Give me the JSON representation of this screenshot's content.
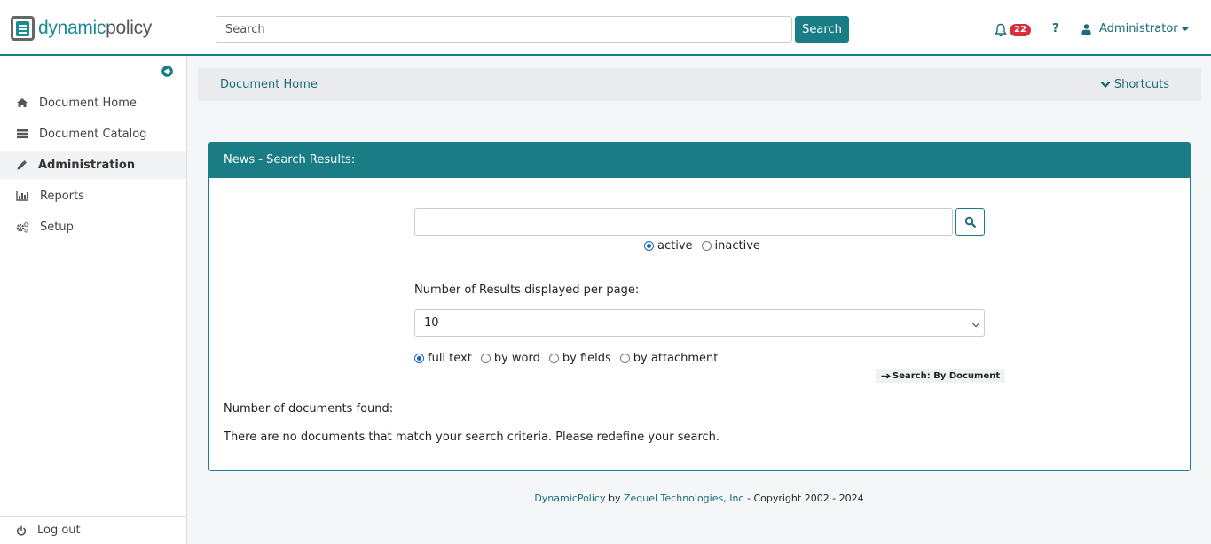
{
  "app": {
    "logo_part1": "dynamic",
    "logo_part2": "policy",
    "logo_text": "dynamicpolicy"
  },
  "topbar": {
    "search_placeholder": "Search",
    "search_button": "Search",
    "notification_count": "22",
    "help_label": "?",
    "user_name": "Administrator"
  },
  "sidebar": {
    "items": [
      {
        "label": "Document Home",
        "icon": "home-icon"
      },
      {
        "label": "Document Catalog",
        "icon": "list-icon"
      },
      {
        "label": "Administration",
        "icon": "pencil-icon",
        "active": true
      },
      {
        "label": "Reports",
        "icon": "bar-chart-icon"
      },
      {
        "label": "Setup",
        "icon": "gears-icon"
      }
    ],
    "logout_label": "Log out"
  },
  "breadcrumb": {
    "current": "Document Home",
    "shortcuts_label": "Shortcuts"
  },
  "panel": {
    "title": "News - Search Results:",
    "search_value": "",
    "status_options": [
      {
        "label": "active",
        "selected": true
      },
      {
        "label": "inactive",
        "selected": false
      }
    ],
    "per_page_label": "Number of Results displayed per page:",
    "per_page_value": "10",
    "mode_options": [
      {
        "label": "full text",
        "selected": true
      },
      {
        "label": "by word",
        "selected": false
      },
      {
        "label": "by fields",
        "selected": false
      },
      {
        "label": "by attachment",
        "selected": false
      }
    ],
    "by_document_link": "Search: By Document",
    "found_label": "Number of documents found:",
    "no_results_message": "There are no documents that match your search criteria. Please redefine your search."
  },
  "footer": {
    "product": "DynamicPolicy",
    "by": "by",
    "company": "Zequel Technologies, Inc",
    "copyright": "- Copyright 2002 - 2024"
  },
  "colors": {
    "accent": "#1a7d86",
    "link": "#1a6b7b",
    "badge": "#d6303c"
  }
}
